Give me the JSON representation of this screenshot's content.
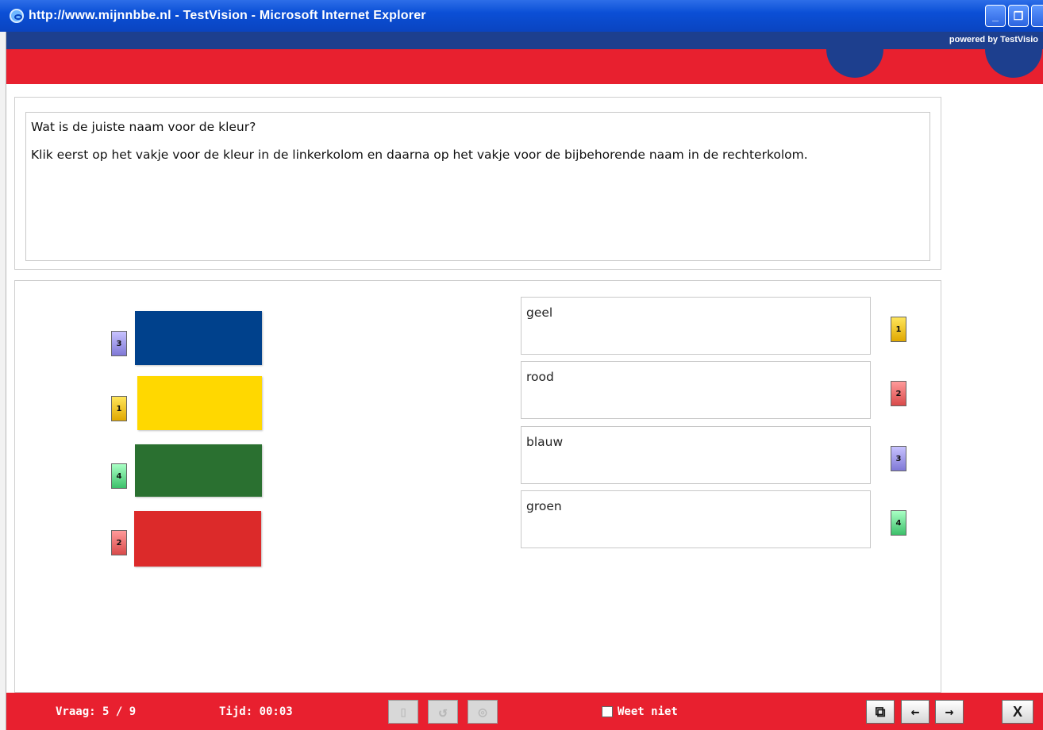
{
  "window": {
    "title": "http://www.mijnnbbe.nl - TestVision - Microsoft Internet Explorer",
    "minimize_glyph": "_",
    "maximize_glyph": "❐"
  },
  "header": {
    "powered_by": "powered by TestVisio",
    "brand_red": "#e8202f",
    "brand_blue": "#1d3f8e"
  },
  "question": {
    "prompt": "Wat is de juiste naam voor de kleur?",
    "instruction": "Klik eerst op het vakje voor de kleur in de linkerkolom en daarna op het vakje voor de bijbehorende naam in de rechterkolom."
  },
  "colors_column": [
    {
      "badge": "3",
      "color": "#00418c"
    },
    {
      "badge": "1",
      "color": "#ffd800"
    },
    {
      "badge": "4",
      "color": "#2a7030"
    },
    {
      "badge": "2",
      "color": "#dc2a2a"
    }
  ],
  "names_column": [
    {
      "name": "geel",
      "badge": "1"
    },
    {
      "name": "rood",
      "badge": "2"
    },
    {
      "name": "blauw",
      "badge": "3"
    },
    {
      "name": "groen",
      "badge": "4"
    }
  ],
  "footer": {
    "question_counter": "Vraag: 5 / 9",
    "timer": "Tijd: 00:03",
    "dont_know_label": "Weet niet",
    "icons": {
      "book": "book-icon",
      "undo": "undo-icon",
      "eye": "eye-icon",
      "copy": "copy-icon",
      "prev": "arrow-left-icon",
      "next": "arrow-right-icon",
      "close": "close-icon"
    },
    "close_label": "X"
  }
}
